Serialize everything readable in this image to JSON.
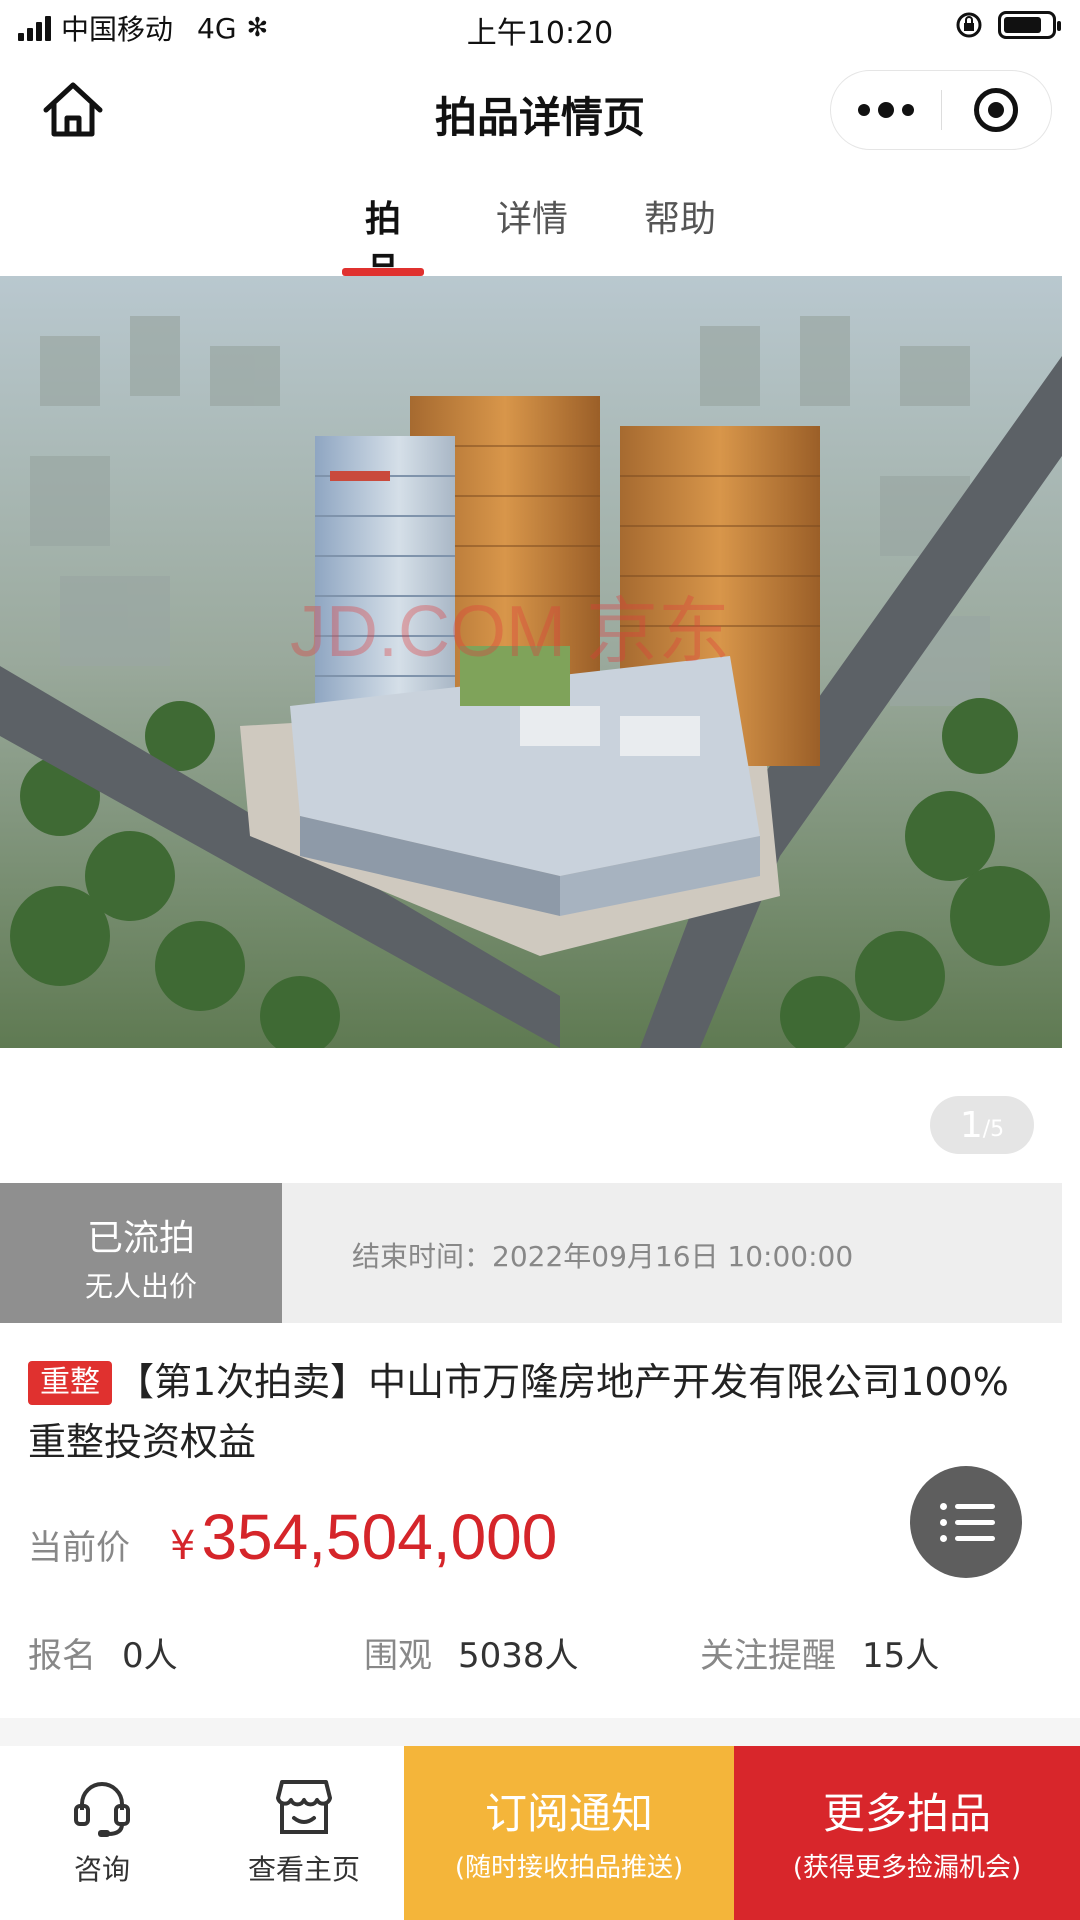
{
  "status_bar": {
    "carrier": "中国移动",
    "network": "4G",
    "time": "上午10:20"
  },
  "nav": {
    "title": "拍品详情页",
    "home_icon": "home-icon",
    "more_icon": "more-dots-icon",
    "close_icon": "target-icon"
  },
  "tabs": [
    {
      "label": "拍品",
      "active": true
    },
    {
      "label": "详情",
      "active": false
    },
    {
      "label": "帮助",
      "active": false
    }
  ],
  "hero": {
    "watermark": "JD.COM 京东",
    "page_current": "1",
    "page_total": "/5"
  },
  "auction_status": {
    "state": "已流拍",
    "sub": "无人出价",
    "end_time": "结束时间：2022年09月16日 10:00:00"
  },
  "item": {
    "badge": "重整",
    "title": "【第1次拍卖】中山市万隆房地产开发有限公司100%重整投资权益"
  },
  "price": {
    "label": "当前价",
    "currency": "¥",
    "value": "354,504,000"
  },
  "stats": [
    {
      "label": "报名",
      "value": "0人"
    },
    {
      "label": "围观",
      "value": "5038人"
    },
    {
      "label": "关注提醒",
      "value": "15人"
    }
  ],
  "bottom_bar": {
    "consult_label": "咨询",
    "home_label": "查看主页",
    "subscribe_main": "订阅通知",
    "subscribe_sub": "(随时接收拍品推送)",
    "more_main": "更多拍品",
    "more_sub": "(获得更多捡漏机会)"
  },
  "colors": {
    "accent_red": "#e0312f",
    "price_red": "#d5252a",
    "subscribe_yellow": "#f4b53a",
    "more_red": "#d8262b",
    "status_gray": "#8f8f8f"
  }
}
